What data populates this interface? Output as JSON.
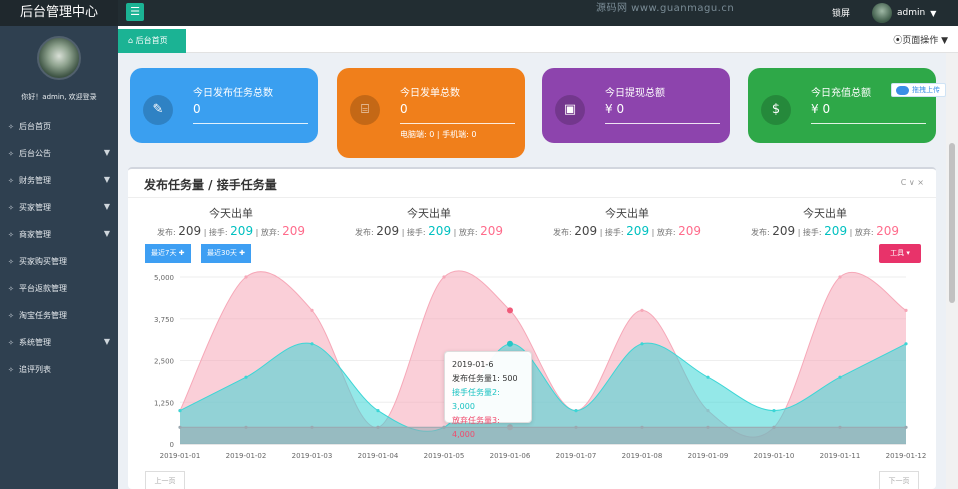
{
  "topbar": {
    "brand": "后台管理中心",
    "menu_icon": "hamburger-icon",
    "watermark": "源码网 www.guanmagu.cn",
    "lock": "锁屏",
    "user": "admin",
    "caret": "▼"
  },
  "sidebar": {
    "welcome": "你好！admin, 欢迎登录",
    "items": [
      {
        "label": "后台首页",
        "dot": "✧",
        "caret": ""
      },
      {
        "label": "后台公告",
        "dot": "✧",
        "caret": "▼"
      },
      {
        "label": "财务管理",
        "dot": "✧",
        "caret": "▼"
      },
      {
        "label": "买家管理",
        "dot": "✧",
        "caret": "▼"
      },
      {
        "label": "商家管理",
        "dot": "✧",
        "caret": "▼"
      },
      {
        "label": "买家购买管理",
        "dot": "✧",
        "caret": ""
      },
      {
        "label": "平台返款管理",
        "dot": "✧",
        "caret": ""
      },
      {
        "label": "淘宝任务管理",
        "dot": "✧",
        "caret": ""
      },
      {
        "label": "系统管理",
        "dot": "✧",
        "caret": "▼"
      },
      {
        "label": "追评列表",
        "dot": "✧",
        "caret": ""
      }
    ]
  },
  "tabs": {
    "home": "后台首页",
    "home_icon": "⌂",
    "page_ops": "⦿页面操作 ▼"
  },
  "cards": [
    {
      "title": "今日发布任务总数",
      "value": "0",
      "sub": "",
      "color": "#3a9ff0",
      "icon": "✎"
    },
    {
      "title": "今日发单总数",
      "value": "0",
      "sub": "电脑端: 0 | 手机端: 0",
      "color": "#f07f1b",
      "icon": "⌸"
    },
    {
      "title": "今日提现总额",
      "value": "¥ 0",
      "sub": "",
      "color": "#8d44ad",
      "icon": "▣"
    },
    {
      "title": "今日充值总额",
      "value": "¥ 0",
      "sub": "",
      "color": "#2ea848",
      "icon": "$"
    }
  ],
  "badge": "拖拽上传",
  "panel": {
    "title": "发布任务量 / 接手任务量",
    "tools": "C ∨ ×"
  },
  "stats": [
    {
      "title": "今天出单",
      "l1": "发布:",
      "v1": "209",
      "l2": "| 接手:",
      "v2": "209",
      "l3": "| 放弃:",
      "v3": "209"
    },
    {
      "title": "今天出单",
      "l1": "发布:",
      "v1": "209",
      "l2": "| 接手:",
      "v2": "209",
      "l3": "| 放弃:",
      "v3": "209"
    },
    {
      "title": "今天出单",
      "l1": "发布:",
      "v1": "209",
      "l2": "| 接手:",
      "v2": "209",
      "l3": "| 放弃:",
      "v3": "209"
    },
    {
      "title": "今天出单",
      "l1": "发布:",
      "v1": "209",
      "l2": "| 接手:",
      "v2": "209",
      "l3": "| 放弃:",
      "v3": "209"
    }
  ],
  "buttons": {
    "last7": "最近7天 ✚",
    "last30": "最近30天 ✚",
    "tools": "工具 ▾",
    "prev": "上一页",
    "next": "下一页"
  },
  "tooltip": {
    "date": "2019-01-6",
    "s1": "发布任务量1: 500",
    "s2": "接手任务量2: 3,000",
    "s3": "放弃任务量3: 4,000"
  },
  "chart_data": {
    "type": "area",
    "x": [
      "2019-01-01",
      "2019-01-02",
      "2019-01-03",
      "2019-01-04",
      "2019-01-05",
      "2019-01-06",
      "2019-01-07",
      "2019-01-08",
      "2019-01-09",
      "2019-01-10",
      "2019-01-11",
      "2019-01-12"
    ],
    "xtick_labels": [
      "2019-01-01",
      "2019-01-02",
      "2019-01-03",
      "2019-01-04",
      "2019-01-05",
      "2019-01-06",
      "2019-01-07",
      "2019-01-08",
      "2019-01-09",
      "2019-01-10",
      "2019-01-11",
      "2019-01-12"
    ],
    "ylim": [
      0,
      5000
    ],
    "yticks": [
      0,
      1250,
      2500,
      3750,
      5000
    ],
    "ytick_labels": [
      "0",
      "1,250",
      "2,500",
      "3,750",
      "5,000"
    ],
    "series": [
      {
        "name": "放弃任务量3",
        "color": "#f6a8b8",
        "values": [
          1000,
          5000,
          4000,
          500,
          5000,
          4000,
          1000,
          4000,
          1000,
          500,
          5000,
          4000
        ],
        "marks": [
          [
            12.0,
            3000
          ],
          [
            12.0,
            5000
          ]
        ]
      },
      {
        "name": "接手任务量2",
        "color": "#3cd6d6",
        "values": [
          1000,
          2000,
          3000,
          1000,
          500,
          3000,
          1000,
          3000,
          2000,
          1000,
          2000,
          3000
        ],
        "marks": [
          [
            12.0,
            2000
          ]
        ]
      },
      {
        "name": "发布任务量1",
        "color": "#9aa8b0",
        "values": [
          500,
          500,
          500,
          500,
          500,
          500,
          500,
          500,
          500,
          500,
          500,
          500
        ],
        "marks": []
      }
    ],
    "grid": true
  }
}
